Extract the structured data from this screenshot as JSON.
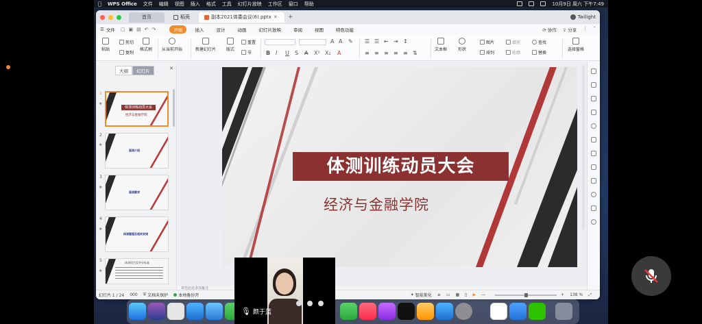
{
  "menubar": {
    "app": "WPS Office",
    "items": [
      "文件",
      "编辑",
      "视图",
      "插入",
      "格式",
      "工具",
      "幻灯片放映",
      "工作区",
      "窗口",
      "帮助"
    ],
    "datetime": "10月9日 周六 下午7:49"
  },
  "titlebar": {
    "home_tab": "首页",
    "draft_tab": "稻壳",
    "doc_tab": "副本2021体委会议(6).pptx",
    "user": "Twilight"
  },
  "ribbon": {
    "file_menu": "文件",
    "tabs": [
      "开始",
      "插入",
      "设计",
      "动画",
      "幻灯片放映",
      "审阅",
      "视图",
      "特色功能"
    ],
    "active_tab": "开始",
    "collaborate": "协作",
    "share": "分享"
  },
  "toolbar": {
    "paste": "粘贴",
    "cut": "剪切",
    "copy": "复制",
    "format_painter": "格式刷",
    "from_current": "从当前开始",
    "new_slide": "新建幻灯片",
    "layout": "版式",
    "reset": "重置",
    "section": "节",
    "textbox": "文本框",
    "shape": "形状",
    "picture": "图片",
    "fill": "填充",
    "find": "查找",
    "arrange": "排列",
    "outline": "轮廓",
    "replace": "替换",
    "select_pane": "选择窗格"
  },
  "leftpanel": {
    "tab_outline": "大纲",
    "tab_slides": "幻灯片",
    "slide_numbers": [
      "1",
      "2",
      "3",
      "4",
      "5"
    ],
    "thumb1_title": "体测训练动员大会",
    "thumb1_sub": "经济与金融学院",
    "thumb2_text": "面测介绍",
    "thumb3_text": "面测要求",
    "thumb4_text": "体测管理及相关安排",
    "thumb5_text": "体测项目及评分标准"
  },
  "slide": {
    "title": "体测训练动员大会",
    "subtitle": "经济与金融学院"
  },
  "notes_placeholder": "单击此处添加备注",
  "status": {
    "slide_pos": "幻灯片 1 / 24",
    "code": "000",
    "doc_unprotected": "文档未保护",
    "local_backup": "本地备份开",
    "smart_beautify": "智能美化",
    "zoom": "138 %",
    "zoom_level": 0.5
  },
  "video": {
    "name": "颜于蓝"
  },
  "colors": {
    "accent": "#f08a2a",
    "slide_red": "#8b3131"
  }
}
